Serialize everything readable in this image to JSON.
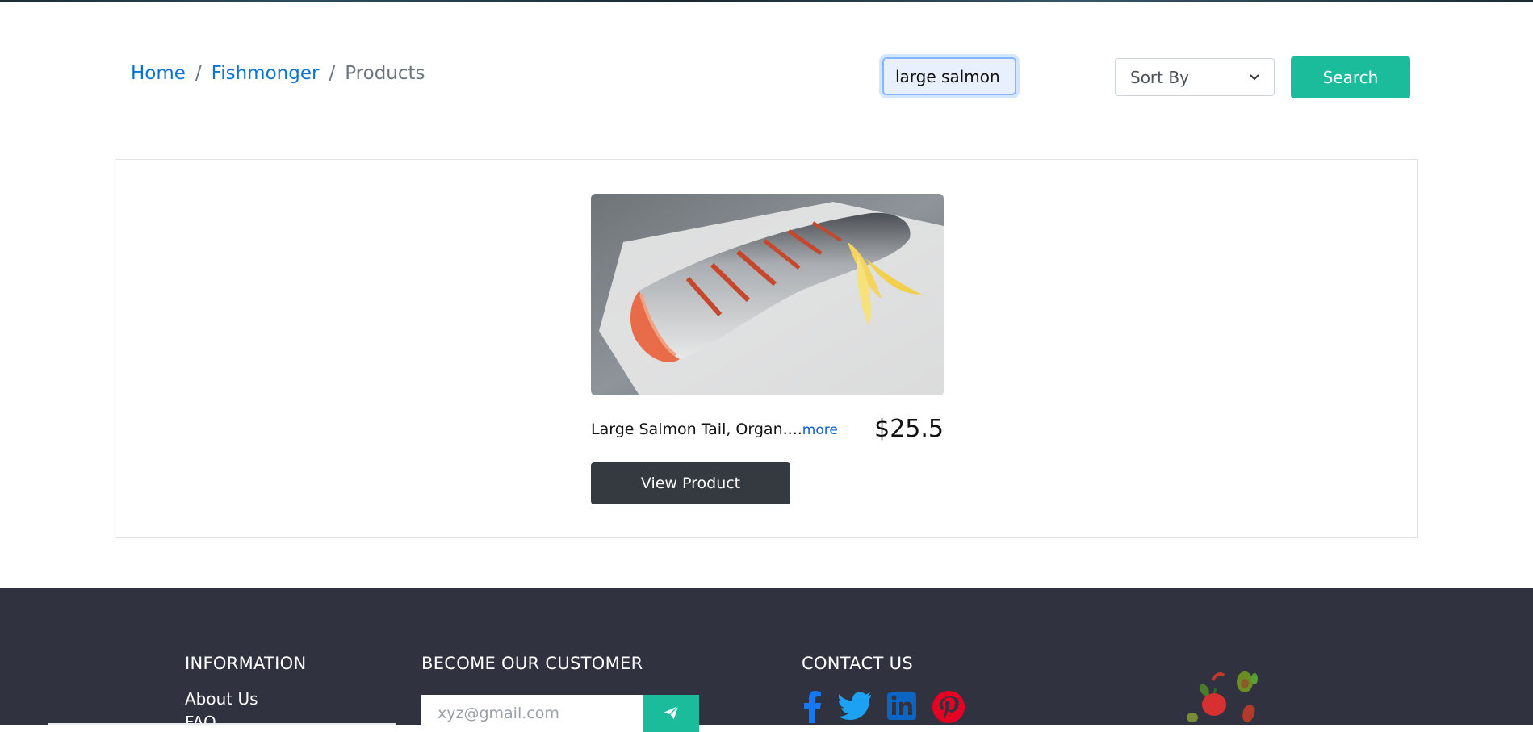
{
  "breadcrumb": {
    "home": "Home",
    "category": "Fishmonger",
    "current": "Products",
    "separator": "/"
  },
  "search": {
    "value": "large salmon",
    "sort_label": "Sort By",
    "button_label": "Search"
  },
  "product": {
    "title": "Large Salmon Tail, Organ....",
    "more_label": "more",
    "price": "$25.5",
    "button_label": "View Product"
  },
  "footer": {
    "information": {
      "heading": "INFORMATION",
      "links": [
        "About Us",
        "FAQ"
      ]
    },
    "customer": {
      "heading": "BECOME OUR CUSTOMER",
      "email_placeholder": "xyz@gmail.com"
    },
    "contact": {
      "heading": "CONTACT US",
      "icons": [
        "facebook-icon",
        "twitter-icon",
        "linkedin-icon",
        "pinterest-icon"
      ]
    }
  },
  "colors": {
    "accent": "#1abc9c",
    "link": "#0b72d6",
    "dark_button": "#343a40",
    "footer_bg": "#30333f"
  }
}
